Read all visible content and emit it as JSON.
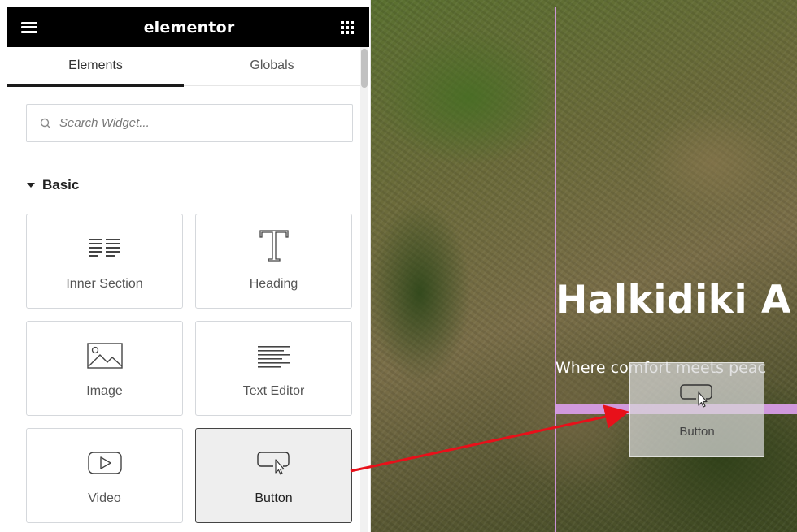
{
  "app": {
    "logo": "elementor"
  },
  "tabs": [
    {
      "label": "Elements",
      "active": true
    },
    {
      "label": "Globals",
      "active": false
    }
  ],
  "search": {
    "placeholder": "Search Widget..."
  },
  "category": {
    "label": "Basic",
    "expanded": true
  },
  "widgets": [
    {
      "label": "Inner Section",
      "icon": "columns-icon"
    },
    {
      "label": "Heading",
      "icon": "heading-t-icon"
    },
    {
      "label": "Image",
      "icon": "image-icon"
    },
    {
      "label": "Text Editor",
      "icon": "text-align-left-icon"
    },
    {
      "label": "Video",
      "icon": "play-icon"
    },
    {
      "label": "Button",
      "icon": "button-cursor-icon",
      "selected": true
    }
  ],
  "canvas": {
    "title": "Halkidiki A",
    "subtitle": "Where comfort meets peac",
    "drag_ghost_label": "Button"
  },
  "colors": {
    "topbar": "#000000",
    "drop_indicator": "#d79ce6",
    "arrow": "#e8101a"
  }
}
